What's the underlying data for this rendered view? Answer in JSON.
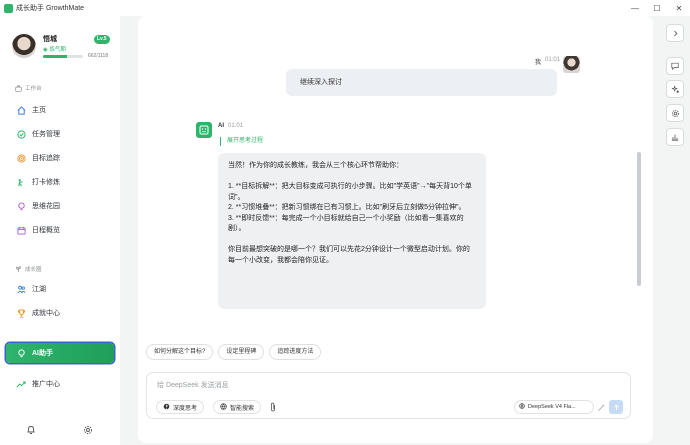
{
  "app": {
    "title": "成长助手 GrowthMate"
  },
  "window_controls": {
    "minimize": "—",
    "maximize": "☐",
    "close": "✕"
  },
  "profile": {
    "name": "悟城",
    "level_badge": "Lv.5",
    "stage": "炼气期",
    "xp_text": "662/1118",
    "xp_progress": 0.59
  },
  "sidebar": {
    "section_workspace": "工作台",
    "workspace_items": [
      {
        "label": "主页",
        "icon": "home-icon"
      },
      {
        "label": "任务管理",
        "icon": "task-check-icon"
      },
      {
        "label": "目标追踪",
        "icon": "target-icon"
      },
      {
        "label": "打卡修炼",
        "icon": "checkin-icon"
      },
      {
        "label": "思维花园",
        "icon": "lightbulb-icon"
      },
      {
        "label": "日程概览",
        "icon": "calendar-icon"
      }
    ],
    "section_growth": "成长圈",
    "growth_items": [
      {
        "label": "江湖",
        "icon": "people-icon"
      },
      {
        "label": "成就中心",
        "icon": "trophy-icon"
      },
      {
        "label": "AI助手",
        "icon": "bulb-icon",
        "active": true
      }
    ],
    "promo_item": {
      "label": "推广中心",
      "icon": "trend-icon"
    },
    "footer": {
      "bell_icon": "bell-icon",
      "settings_icon": "gear-icon"
    }
  },
  "chat": {
    "user_message": {
      "sender": "我",
      "time": "01:01",
      "text": "继续深入探讨"
    },
    "ai_message": {
      "sender": "AI",
      "time": "01:01",
      "thinking_toggle": "展开思考过程",
      "text": "当然！作为你的成长教练，我会从三个核心环节帮助你：\n\n1. **目标拆解**：把大目标变成可执行的小步骤。比如\"学英语\"→\"每天背10个单词\"。\n2. **习惯堆叠**：把新习惯绑在已有习惯上。比如\"刷牙后立刻做5分钟拉伸\"。\n3. **即时反馈**：每完成一个小目标就给自己一个小奖励（比如看一集喜欢的剧）。\n\n你目前最想突破的是哪一个？我们可以先花2分钟设计一个微型启动计划。你的每一个小改变，我都会陪你见证。"
    }
  },
  "suggestions": [
    "如何分解这个目标?",
    "设定里程碑",
    "追踪进度方法"
  ],
  "composer": {
    "placeholder": "给 DeepSeek 发送消息",
    "deep_think_label": "深度思考",
    "web_search_label": "智能搜索",
    "model_label": "DeepSeek V4 Fla..."
  },
  "rightbar": {
    "icons": [
      "chevron-right-icon",
      "chat-icon",
      "sparkle-icon",
      "gear-icon",
      "chart-icon"
    ]
  },
  "colors": {
    "accent": "#2fb46b",
    "accent_dark": "#1e9f5a",
    "focus_ring": "#3c5fd8",
    "bubble": "#eef0f2"
  }
}
